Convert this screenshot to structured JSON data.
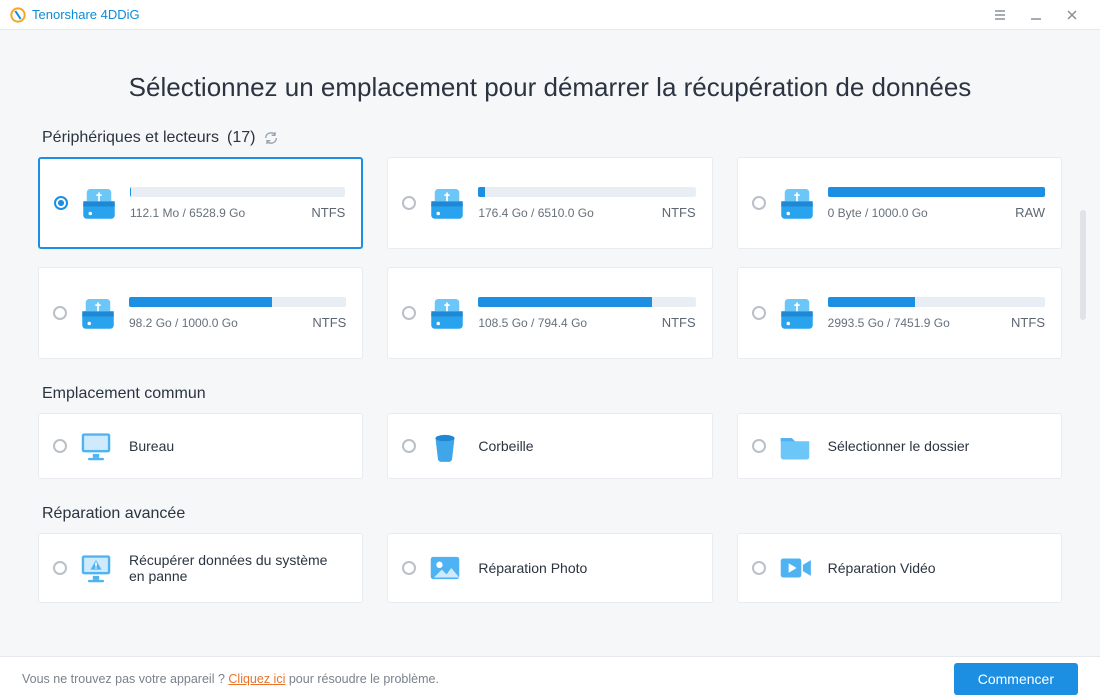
{
  "app_title": "Tenorshare 4DDiG",
  "headline": "Sélectionnez un emplacement pour démarrer la récupération de données",
  "drives_section": {
    "title_prefix": "Périphériques et lecteurs",
    "count": "(17)",
    "items": [
      {
        "used": "112.1 Mo",
        "total": "6528.9 Go",
        "fs": "NTFS",
        "pct": 0.5,
        "selected": true
      },
      {
        "used": "176.4 Go",
        "total": "6510.0 Go",
        "fs": "NTFS",
        "pct": 3,
        "selected": false
      },
      {
        "used": "0 Byte",
        "total": "1000.0 Go",
        "fs": "RAW",
        "pct": 100,
        "selected": false
      },
      {
        "used": "98.2 Go",
        "total": "1000.0 Go",
        "fs": "NTFS",
        "pct": 66,
        "selected": false
      },
      {
        "used": "108.5 Go",
        "total": "794.4 Go",
        "fs": "NTFS",
        "pct": 80,
        "selected": false
      },
      {
        "used": "2993.5 Go",
        "total": "7451.9 Go",
        "fs": "NTFS",
        "pct": 40,
        "selected": false
      }
    ]
  },
  "common_section": {
    "title": "Emplacement commun",
    "items": [
      {
        "label": "Bureau",
        "icon": "monitor"
      },
      {
        "label": "Corbeille",
        "icon": "trash"
      },
      {
        "label": "Sélectionner le dossier",
        "icon": "folder"
      }
    ]
  },
  "advanced_section": {
    "title": "Réparation avancée",
    "items": [
      {
        "label": "Récupérer données du système en panne",
        "icon": "crash"
      },
      {
        "label": "Réparation Photo",
        "icon": "photo"
      },
      {
        "label": "Réparation Vidéo",
        "icon": "video"
      }
    ]
  },
  "footer": {
    "q": "Vous ne trouvez pas votre appareil ? ",
    "link": "Cliquez ici",
    "tail": " pour résoudre le problème.",
    "button": "Commencer"
  }
}
